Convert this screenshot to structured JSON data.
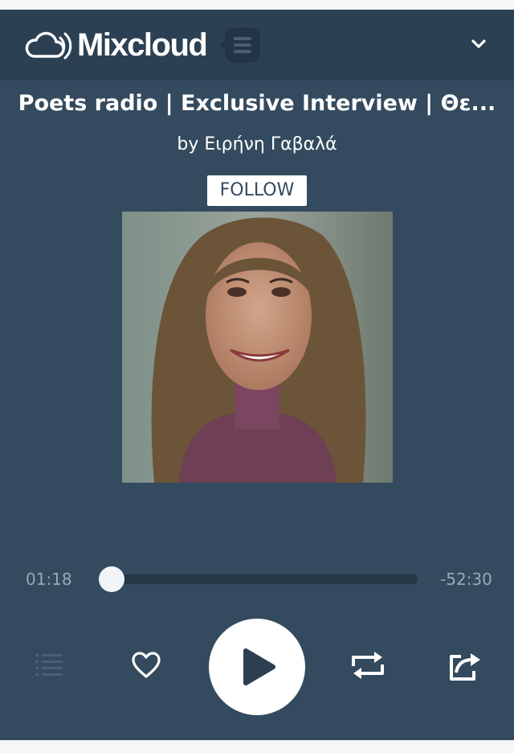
{
  "header": {
    "brand": "Mixcloud",
    "icons": {
      "logo": "cloud-logo-icon",
      "menu": "menu-icon",
      "collapse": "chevron-down-icon"
    }
  },
  "show": {
    "title": "Poets radio | Exclusive Interview | Θε...",
    "byline": "by Ειρήνη Γαβαλά",
    "follow_label": "FOLLOW"
  },
  "progress": {
    "elapsed": "01:18",
    "remaining": "-52:30",
    "fraction": 0.024
  },
  "controls": {
    "icons": [
      "tracklist-icon",
      "heart-icon",
      "play-icon",
      "repeat-icon",
      "share-icon"
    ]
  },
  "colors": {
    "player_bg": "#344a5e",
    "header_bg": "#2c4053",
    "text": "#ffffff",
    "muted_text": "#9aa8b6"
  }
}
